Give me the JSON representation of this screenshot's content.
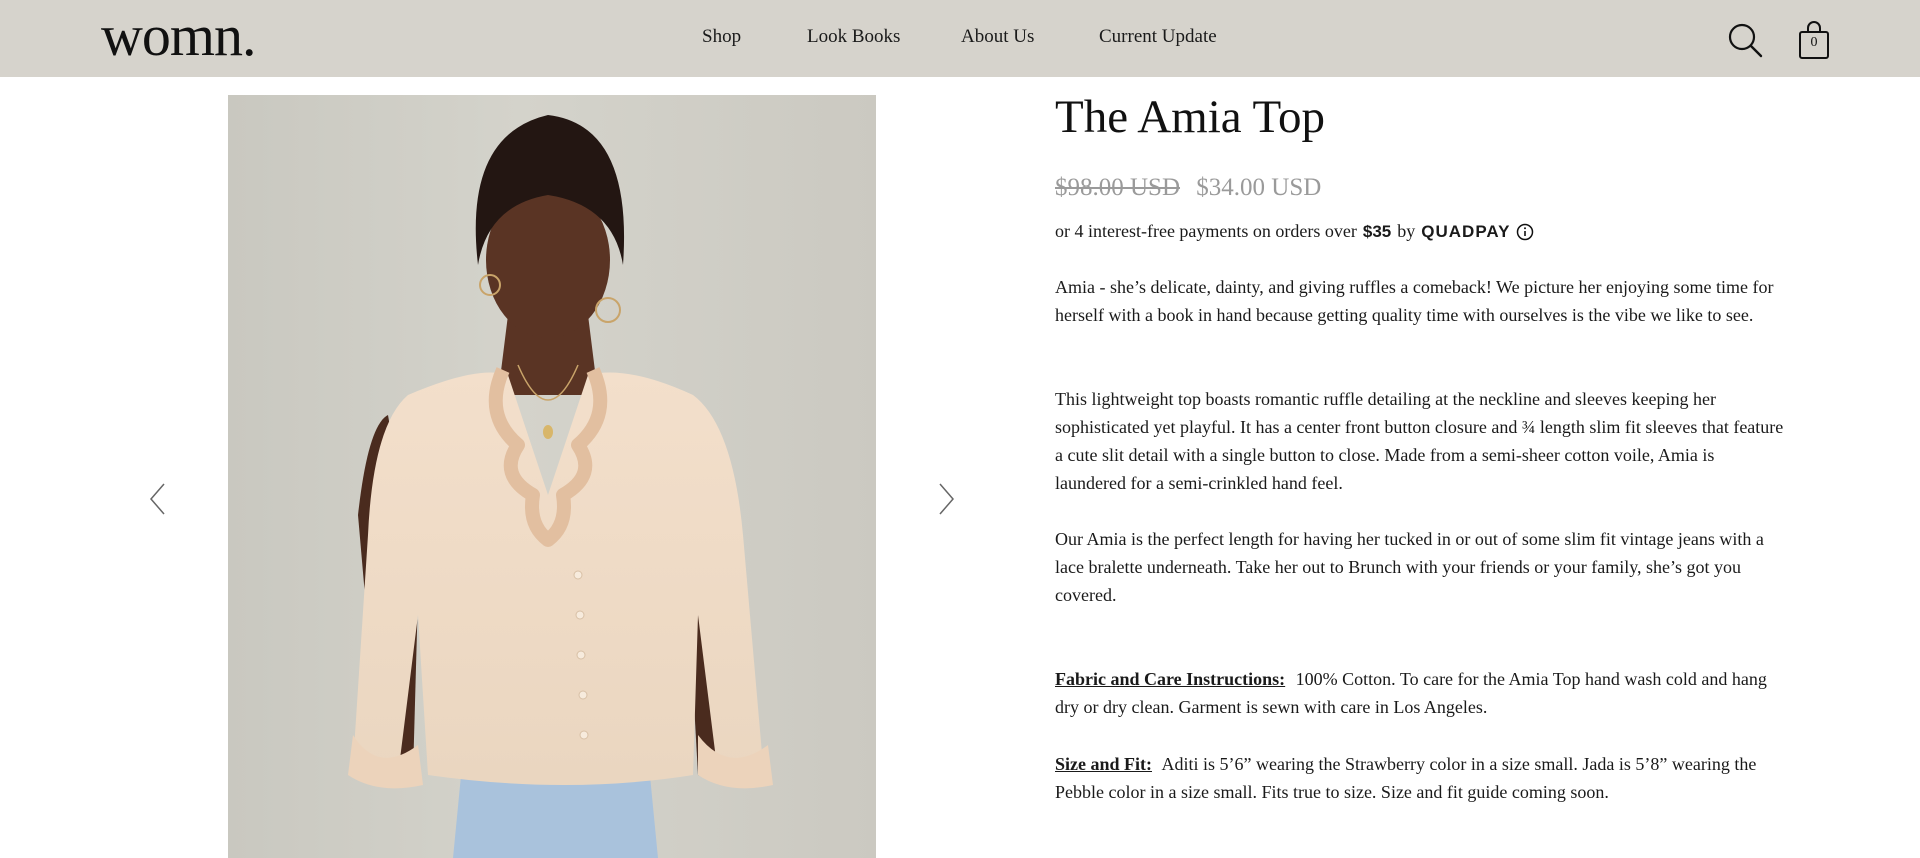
{
  "header": {
    "logo": "womn.",
    "nav": [
      "Shop",
      "Look Books",
      "About Us",
      "Current Update"
    ],
    "search_icon": "search-icon",
    "cart_icon": "shopping-bag-icon",
    "cart_count": "0"
  },
  "gallery": {
    "prev_icon": "chevron-left-icon",
    "next_icon": "chevron-right-icon"
  },
  "product": {
    "title": "The Amia Top",
    "price_original": "$98.00 USD",
    "price_sale": "$34.00 USD",
    "quadpay": {
      "prefix": "or 4 interest-free payments on orders over",
      "amount": "$35",
      "by": "by",
      "brand": "QUADPAY",
      "info_icon": "info-icon"
    },
    "description": [
      "Amia - she’s delicate, dainty, and giving ruffles a comeback! We picture her enjoying some time for herself with a book in hand because getting quality time with ourselves is the vibe we like to see.",
      "This lightweight top boasts romantic ruffle detailing at the neckline and sleeves keeping her sophisticated yet playful. It has a center front button closure and ¾ length slim fit sleeves that feature a cute slit detail with a single button to close. Made from a semi-sheer cotton voile, Amia is laundered for a semi-crinkled hand feel.",
      "Our Amia is the perfect length for having her tucked in or out of some slim fit vintage jeans with a lace bralette underneath. Take her out to Brunch with your friends or your family, she’s got you covered."
    ],
    "fabric_label": "Fabric and Care Instructions:",
    "fabric_text": "100% Cotton. To care for the Amia Top hand wash cold and hang dry or dry clean. Garment is sewn with care in Los Angeles.",
    "size_label": "Size and Fit:",
    "size_text": "Aditi is 5’6” wearing the Strawberry color in a size small. Jada is 5’8” wearing the Pebble color in a size small. Fits true to size. Size and fit guide coming soon."
  },
  "colors": {
    "header_bg": "#d6d3cc",
    "price_muted": "#9a9a9a",
    "text": "#1a1a1a"
  }
}
